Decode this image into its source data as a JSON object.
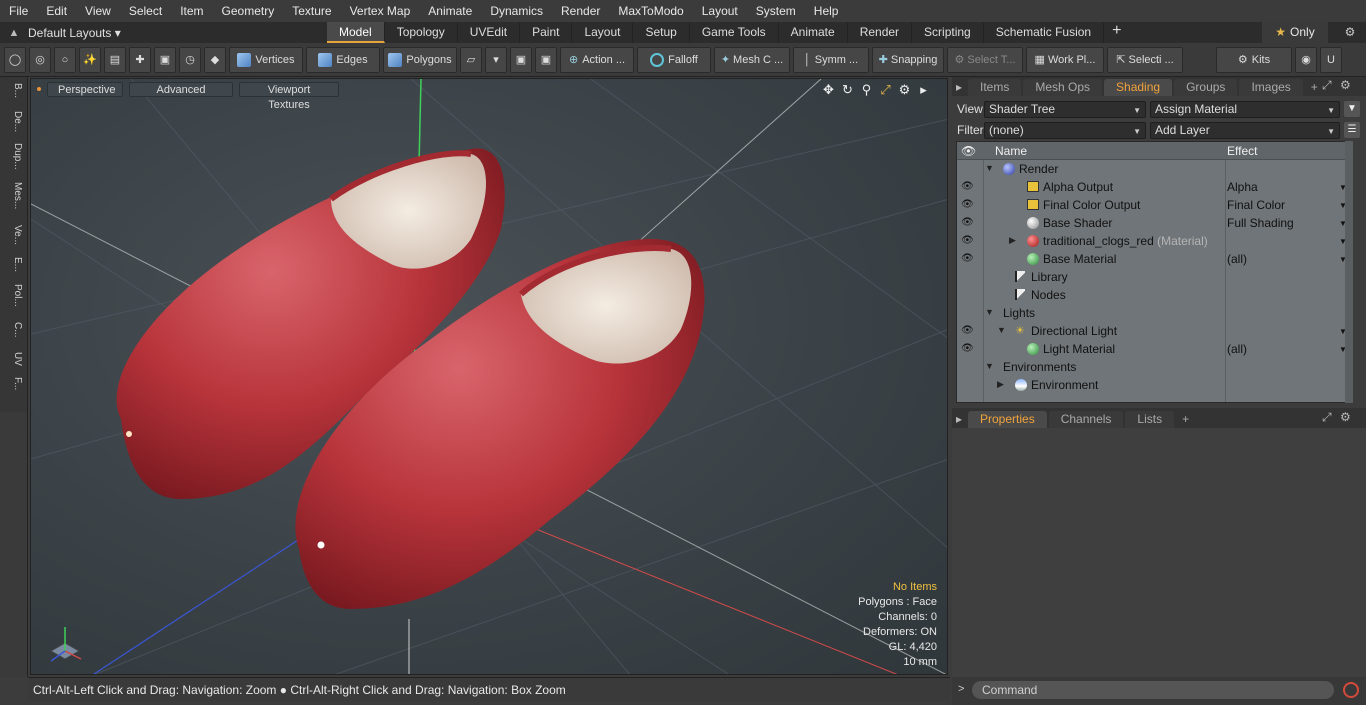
{
  "menu": [
    "File",
    "Edit",
    "View",
    "Select",
    "Item",
    "Geometry",
    "Texture",
    "Vertex Map",
    "Animate",
    "Dynamics",
    "Render",
    "MaxToModo",
    "Layout",
    "System",
    "Help"
  ],
  "layoutbar": {
    "layout_label": "Default Layouts ▾",
    "tabs": [
      "Model",
      "Topology",
      "UVEdit",
      "Paint",
      "Layout",
      "Setup",
      "Game Tools",
      "Animate",
      "Render",
      "Scripting",
      "Schematic Fusion"
    ],
    "active_tab": "Model",
    "plus": "+",
    "only_label": "Only",
    "star": "★"
  },
  "toolbar": {
    "vertices": "Vertices",
    "edges": "Edges",
    "polygons": "Polygons",
    "action": "Action ...",
    "falloff": "Falloff",
    "mesh": "Mesh C ...",
    "symm": "Symm ...",
    "snapping": "Snapping",
    "select_t": "Select T...",
    "workpl": "Work Pl...",
    "selecti": "Selecti ...",
    "kits": "Kits"
  },
  "left_tabs": [
    "B...",
    "De...",
    "Dup...",
    "Mes...",
    "Ve...",
    "E...",
    "Pol...",
    "C...",
    "UV",
    "F..."
  ],
  "viewport": {
    "perspective": "Perspective",
    "advanced": "Advanced",
    "textures": "Viewport Textures",
    "info": {
      "no_items": "No Items",
      "polygons": "Polygons : Face",
      "channels": "Channels: 0",
      "deformers": "Deformers: ON",
      "gl": "GL: 4,420",
      "scale": "10 mm"
    }
  },
  "status": "Ctrl-Alt-Left Click and Drag: Navigation: Zoom ● Ctrl-Alt-Right Click and Drag: Navigation: Box Zoom",
  "right_panel": {
    "tabs": [
      "Items",
      "Mesh Ops",
      "Shading",
      "Groups",
      "Images"
    ],
    "active_tab": "Shading",
    "view_label": "View",
    "view_value": "Shader Tree",
    "assign_material": "Assign Material",
    "filter_label": "Filter",
    "filter_value": "(none)",
    "add_layer": "Add Layer",
    "col_name": "Name",
    "col_effect": "Effect",
    "tree": [
      {
        "name": "Render",
        "effect": "",
        "eye": false,
        "indent": 0,
        "arrow": "▼",
        "icon": "sphere-blue"
      },
      {
        "name": "Alpha Output",
        "effect": "Alpha",
        "eye": true,
        "indent": 2,
        "arrow": "",
        "icon": "output"
      },
      {
        "name": "Final Color Output",
        "effect": "Final Color",
        "eye": true,
        "indent": 2,
        "arrow": "",
        "icon": "output"
      },
      {
        "name": "Base Shader",
        "effect": "Full Shading",
        "eye": true,
        "indent": 2,
        "arrow": "",
        "icon": "sphere-white"
      },
      {
        "name": "traditional_clogs_red",
        "suffix": "(Material)",
        "effect": "",
        "eye": true,
        "indent": 2,
        "arrow": "▶",
        "icon": "sphere-red"
      },
      {
        "name": "Base Material",
        "effect": "(all)",
        "eye": true,
        "indent": 2,
        "arrow": "",
        "icon": "sphere-green"
      },
      {
        "name": "Library",
        "effect": "",
        "eye": false,
        "indent": 1,
        "arrow": "",
        "icon": "flag"
      },
      {
        "name": "Nodes",
        "effect": "",
        "eye": false,
        "indent": 1,
        "arrow": "",
        "icon": "flag"
      },
      {
        "name": "Lights",
        "effect": "",
        "eye": false,
        "indent": 0,
        "arrow": "▼",
        "icon": "none"
      },
      {
        "name": "Directional Light",
        "effect": "",
        "eye": true,
        "indent": 1,
        "arrow": "▼",
        "icon": "light"
      },
      {
        "name": "Light Material",
        "effect": "(all)",
        "eye": true,
        "indent": 2,
        "arrow": "",
        "icon": "sphere-green"
      },
      {
        "name": "Environments",
        "effect": "",
        "eye": false,
        "indent": 0,
        "arrow": "▼",
        "icon": "none"
      },
      {
        "name": "Environment",
        "effect": "",
        "eye": false,
        "indent": 1,
        "arrow": "▶",
        "icon": "sphere-env"
      }
    ],
    "props_tabs": [
      "Properties",
      "Channels",
      "Lists"
    ],
    "props_active": "Properties",
    "command_placeholder": "Command",
    "prompt": ">"
  },
  "colors": {
    "accent": "#f2a33b",
    "clog_red": "#b8343b",
    "grid": "#5a6368"
  }
}
